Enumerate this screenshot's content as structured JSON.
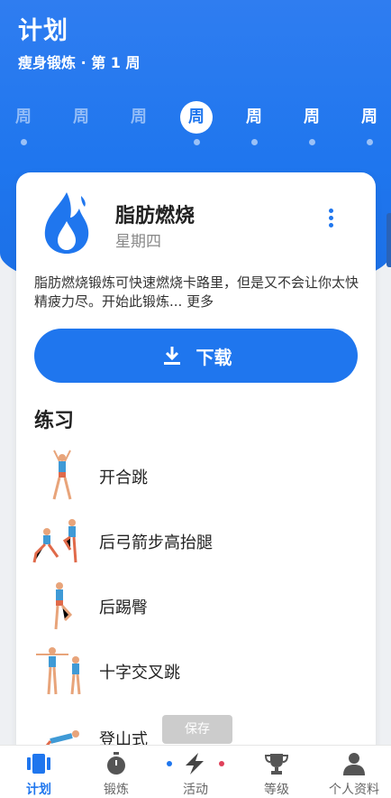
{
  "header": {
    "title": "计划",
    "subtitle": "瘦身锻炼 · 第 1 周"
  },
  "days": [
    {
      "label": "周",
      "state": "past"
    },
    {
      "label": "周",
      "state": "past"
    },
    {
      "label": "周",
      "state": "past"
    },
    {
      "label": "周",
      "state": "current"
    },
    {
      "label": "周",
      "state": "future"
    },
    {
      "label": "周",
      "state": "future"
    },
    {
      "label": "周",
      "state": "future"
    }
  ],
  "workout": {
    "icon": "flame-icon",
    "name": "脂肪燃烧",
    "day": "星期四",
    "description": "脂肪燃烧锻炼可快速燃烧卡路里，但是又不会让你太快精疲力尽。开始此锻炼...",
    "more_link": "更多",
    "download_label": "下载"
  },
  "section_title": "练习",
  "exercises": [
    {
      "name": "开合跳"
    },
    {
      "name": "后弓箭步高抬腿"
    },
    {
      "name": "后踢臀"
    },
    {
      "name": "十字交叉跳"
    },
    {
      "name": "登山式"
    }
  ],
  "toast": "保存",
  "nav": [
    {
      "label": "计划",
      "icon": "plan-icon",
      "active": true
    },
    {
      "label": "锻炼",
      "icon": "stopwatch-icon",
      "active": false
    },
    {
      "label": "活动",
      "icon": "activity-icon",
      "active": false
    },
    {
      "label": "等级",
      "icon": "trophy-icon",
      "active": false
    },
    {
      "label": "个人资料",
      "icon": "person-icon",
      "active": false
    }
  ],
  "colors": {
    "accent": "#1f76ee",
    "hero": "#2f7df0",
    "text": "#222222",
    "muted": "#888888"
  }
}
